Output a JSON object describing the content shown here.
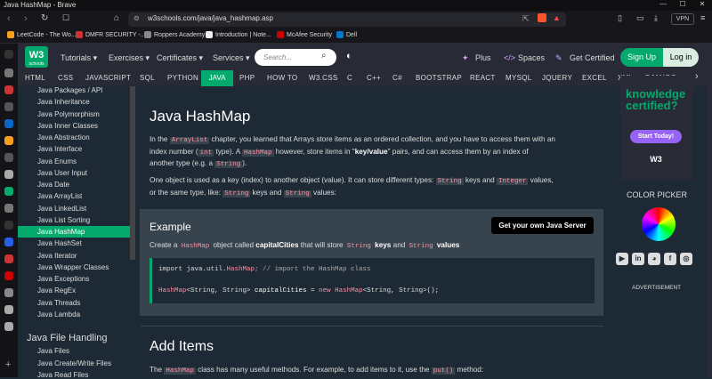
{
  "window": {
    "title": "Java HashMap - Brave"
  },
  "browser": {
    "url": "w3schools.com/java/java_hashmap.asp",
    "vpn_label": "VPN",
    "bookmarks": [
      {
        "label": "LeetCode - The Wo...",
        "color": "#f89f1b"
      },
      {
        "label": "DMFR SECURITY -...",
        "color": "#c33"
      },
      {
        "label": "Roppers Academy",
        "color": "#888"
      },
      {
        "label": "Introduction | Note...",
        "color": "#eee"
      },
      {
        "label": "McAfee Security",
        "color": "#c00"
      },
      {
        "label": "Dell",
        "color": "#0076ce"
      }
    ]
  },
  "header": {
    "logo": "W3",
    "logo_sub": "schools",
    "menus": [
      "Tutorials ▾",
      "Exercises ▾",
      "Certificates ▾",
      "Services ▾"
    ],
    "search_placeholder": "Search...",
    "plus": "Plus",
    "spaces": "Spaces",
    "get_certified": "Get Certified",
    "signup": "Sign Up",
    "login": "Log in"
  },
  "topnav": [
    "HTML",
    "CSS",
    "JAVASCRIPT",
    "SQL",
    "PYTHON",
    "JAVA",
    "PHP",
    "HOW TO",
    "W3.CSS",
    "C",
    "C++",
    "C#",
    "BOOTSTRAP",
    "REACT",
    "MYSQL",
    "JQUERY",
    "EXCEL",
    "XML",
    "DJANGO"
  ],
  "sidebar": {
    "items": [
      "Java Packages / API",
      "Java Inheritance",
      "Java Polymorphism",
      "Java Inner Classes",
      "Java Abstraction",
      "Java Interface",
      "Java Enums",
      "Java User Input",
      "Java Date",
      "Java ArrayList",
      "Java LinkedList",
      "Java List Sorting",
      "Java HashMap",
      "Java HashSet",
      "Java Iterator",
      "Java Wrapper Classes",
      "Java Exceptions",
      "Java RegEx",
      "Java Threads",
      "Java Lambda"
    ],
    "active": "Java HashMap",
    "section_heading": "Java File Handling",
    "section_items": [
      "Java Files",
      "Java Create/Write Files",
      "Java Read Files"
    ]
  },
  "main": {
    "title": "Java HashMap",
    "p1": {
      "a": "In the ",
      "c1": "ArrayList",
      "b": " chapter, you learned that Arrays store items as an ordered collection, and you have to access them with an",
      "d": "index number (",
      "c2": "int",
      "e": " type). A ",
      "c3": "HashMap",
      "f": " however, store items in \"",
      "g": "key/value",
      "h": "\" pairs, and can access them by an index of",
      "i": "another type (e.g. a ",
      "c4": "String",
      "j": ")."
    },
    "p2": {
      "a": "One object is used as a key (index) to another object (value). It can store different types: ",
      "c1": "String",
      "b": " keys and ",
      "c2": "Integer",
      "c": " values,",
      "d": "or the same type, like: ",
      "c3": "String",
      "e": " keys and ",
      "c4": "String",
      "f": " values:"
    },
    "example": {
      "heading": "Example",
      "button": "Get your own Java Server",
      "desc_a": "Create a ",
      "desc_c1": "HashMap",
      "desc_b": " object called ",
      "desc_bold1": "capitalCities",
      "desc_c": " that will store ",
      "desc_c2": "String",
      "desc_bold2": " keys",
      "desc_d": " and ",
      "desc_c3": "String",
      "desc_bold3": " values",
      "code_line1_a": "import java.util.",
      "code_line1_b": "HashMap",
      "code_line1_c": "; // import the HashMap class",
      "code_line2": {
        "t1": "HashMap",
        "t2": "<String, String> ",
        "t3": "capitalCities",
        "t4": " = ",
        "t5": "new",
        "t6": " HashMap",
        "t7": "<String, String>",
        "t8": "();"
      }
    },
    "h2": "Add Items",
    "p3": {
      "a": "The ",
      "c1": "HashMap",
      "b": " class has many useful methods. For example, to add items to it, use the ",
      "c2": "put()",
      "c": " method:"
    }
  },
  "right": {
    "ad_text": "knowledge certified?",
    "ad_button": "Start Today!",
    "ad_logo": "W3",
    "color_picker": "COLOR PICKER",
    "social": [
      "youtube-icon",
      "linkedin-icon",
      "discord-icon",
      "facebook-icon",
      "instagram-icon"
    ],
    "advertisement": "ADVERTISEMENT"
  },
  "colors": {
    "accent": "#04aa6d",
    "bg": "#1d2a35",
    "panel": "#38444d",
    "header": "#282a35"
  }
}
